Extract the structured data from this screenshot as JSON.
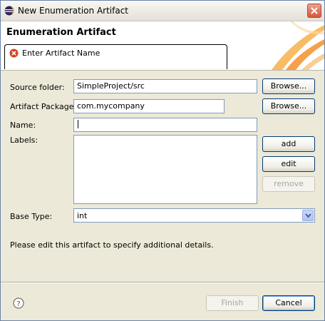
{
  "window": {
    "title": "New Enumeration Artifact",
    "title_icon": "eclipse-icon",
    "close_icon": "close-icon"
  },
  "banner": {
    "title": "Enumeration Artifact",
    "message": "Enter Artifact Name",
    "message_icon": "error-icon"
  },
  "form": {
    "source_folder_label": "Source folder:",
    "source_folder_value": "SimpleProject/src",
    "package_label": "Artifact Package:",
    "package_value": "com.mycompany",
    "name_label": "Name:",
    "name_value": "",
    "labels_label": "Labels:",
    "base_type_label": "Base Type:",
    "base_type_value": "int",
    "info_text": "Please edit this artifact to specify additional details."
  },
  "buttons": {
    "browse": "Browse...",
    "add": "add",
    "edit": "edit",
    "remove": "remove",
    "finish": "Finish",
    "cancel": "Cancel"
  },
  "footer": {
    "help_icon": "help-icon"
  }
}
